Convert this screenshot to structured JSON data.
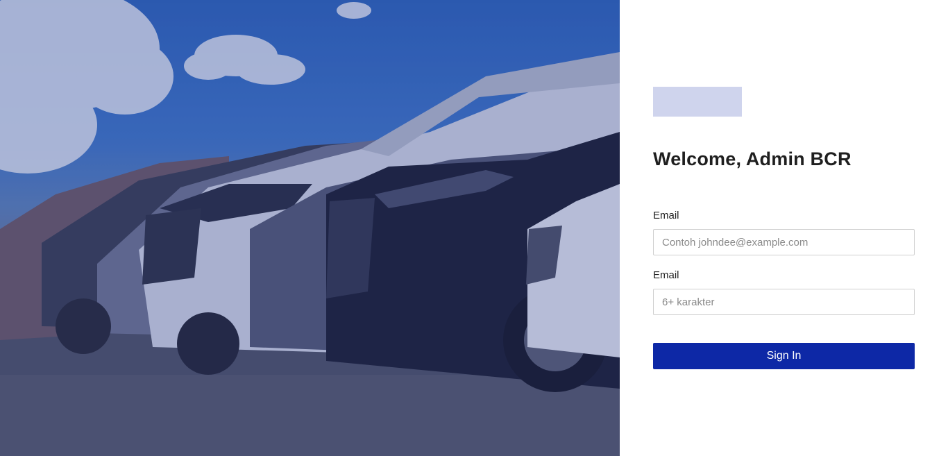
{
  "hero": {
    "image": "parked-cars-photo"
  },
  "logo": {
    "icon": "logo-placeholder"
  },
  "login": {
    "title": "Welcome, Admin BCR",
    "email_label": "Email",
    "email_placeholder": "Contoh johndee@example.com",
    "email_value": "",
    "password_label": "Email",
    "password_placeholder": "6+ karakter",
    "password_value": "",
    "submit_label": "Sign In"
  },
  "colors": {
    "primary": "#0d28a6",
    "logo_box": "#cfd4ed",
    "hero_overlay": "#1a2a8a"
  }
}
